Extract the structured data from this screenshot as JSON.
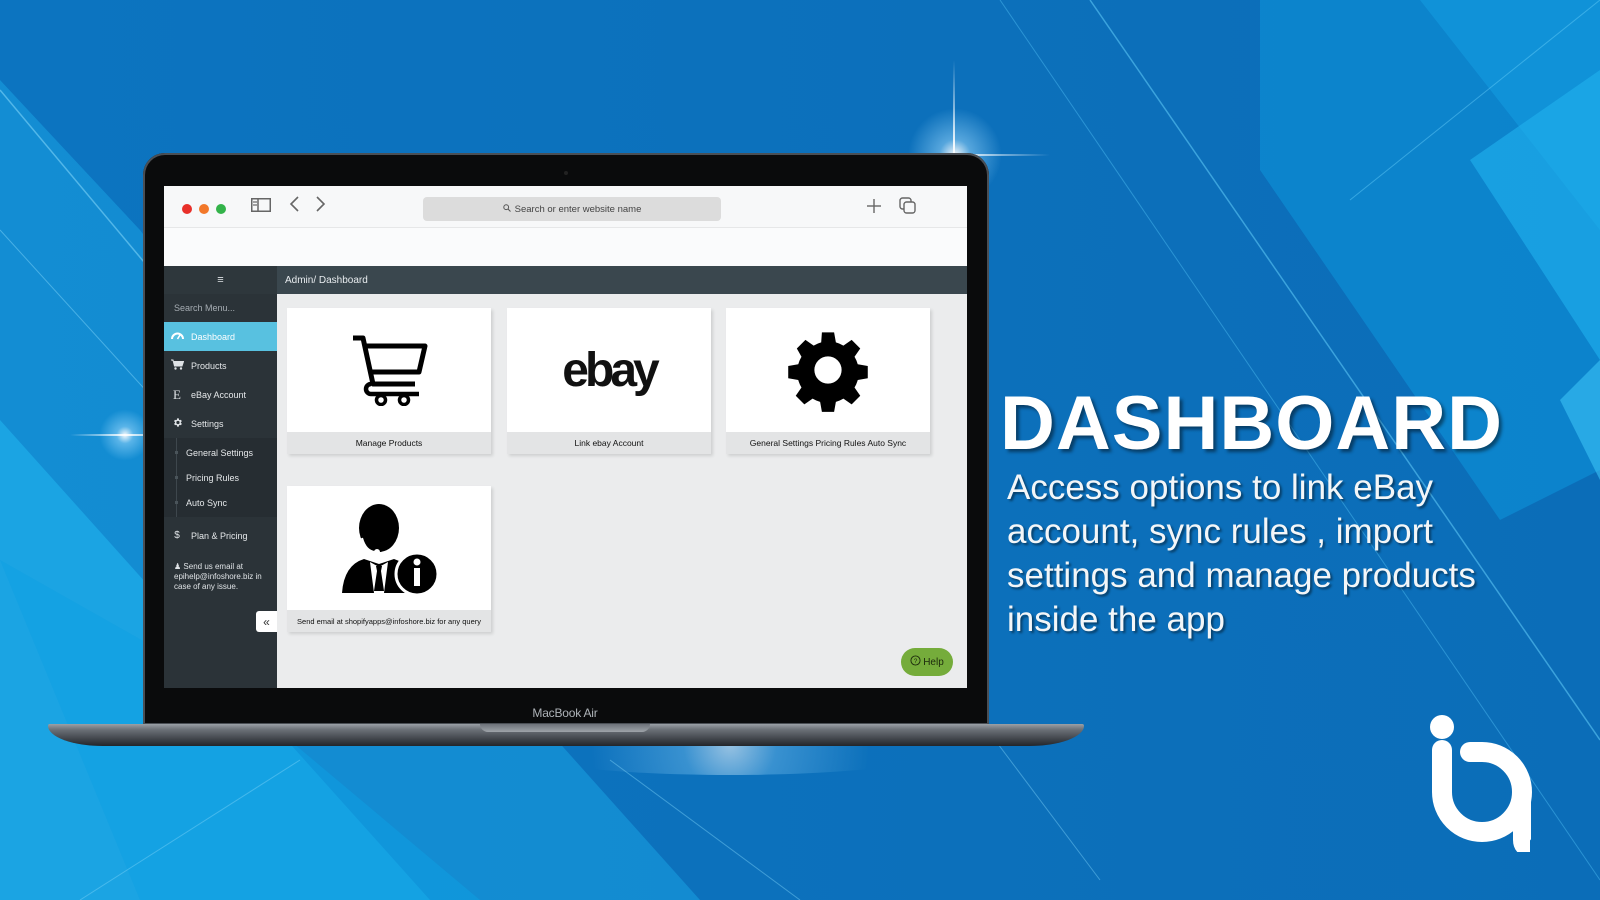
{
  "browser": {
    "address_placeholder": "Search or enter website name"
  },
  "app": {
    "breadcrumb": "Admin/ Dashboard",
    "menu_icon": "≡",
    "search_placeholder": "Search Menu...",
    "sidebar": {
      "items": [
        {
          "label": "Dashboard",
          "icon": "dashboard-gauge-icon",
          "active": true
        },
        {
          "label": "Products",
          "icon": "cart-icon",
          "active": false
        },
        {
          "label": "eBay Account",
          "icon": "ebay-e-icon",
          "active": false
        },
        {
          "label": "Settings",
          "icon": "gear-icon",
          "active": false
        }
      ],
      "sub_items": [
        {
          "label": "General Settings"
        },
        {
          "label": "Pricing Rules"
        },
        {
          "label": "Auto Sync"
        }
      ],
      "plan_label": "Plan & Pricing",
      "help_text": "Send us email at epihelp@infoshore.biz in case of any issue.",
      "collapse_glyph": "«"
    },
    "cards": [
      {
        "caption": "Manage Products",
        "icon": "shopping-cart-icon"
      },
      {
        "caption": "Link ebay Account",
        "icon": "ebay-logo",
        "logo_text": "ebay"
      },
      {
        "caption": "General Settings Pricing Rules Auto Sync",
        "icon": "gear-icon"
      },
      {
        "caption": "Send email at shopifyapps@infoshore.biz for any query",
        "icon": "support-agent-icon"
      }
    ],
    "help_button": "Help"
  },
  "device_label": "MacBook Air",
  "hero": {
    "title": "DASHBOARD",
    "description": "Access options to  link eBay account, sync rules , import settings and manage products inside the app"
  },
  "colors": {
    "background": "#0c72bd",
    "sidebar": "#2b3338",
    "active_item": "#58c1e0",
    "help_button": "#75ac3b"
  }
}
